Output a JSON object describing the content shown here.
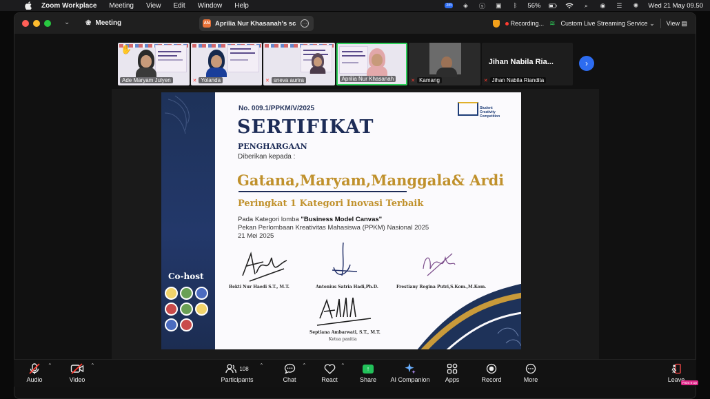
{
  "menubar": {
    "app": "Zoom Workplace",
    "items": [
      "Meeting",
      "View",
      "Edit",
      "Window",
      "Help"
    ],
    "battery": "56%",
    "zoom_badge": "zm",
    "datetime": "Wed 21 May  09.50"
  },
  "titlebar": {
    "meeting_label": "Meeting",
    "share_initials": "AN",
    "share_label": "Aprilia Nur Khasanah's scree",
    "recording": "Recording...",
    "stream": "Custom Live Streaming Service",
    "view": "View"
  },
  "participants": [
    {
      "name": "Ade Maryam Julyen",
      "muted": false
    },
    {
      "name": "Yolanda",
      "muted": true
    },
    {
      "name": "sneva aurira",
      "muted": true
    },
    {
      "name": "Aprilia Nur Khasanah",
      "muted": false,
      "active": true
    },
    {
      "name": "Kamang",
      "muted": true
    },
    {
      "name": "Jihan Nabila Riandita",
      "display": "Jihan Nabila Ria...",
      "muted": true
    }
  ],
  "thumb_poster": {
    "line1": "ANNOUNCEMENT",
    "line2": "OF THE WINNER",
    "line3": "Student Creativity",
    "line4": "Competition 2025"
  },
  "certificate": {
    "number": "No.  009.1/PPKM/V/2025",
    "title": "SERTIFIKAT",
    "subtitle": "PENGHARGAAN",
    "given_to": "Diberikan kepada :",
    "names": "Gatana,Maryam,Manggala& Ardi",
    "rank": "Peringkat 1 Kategori Inovasi Terbaik",
    "category_prefix": "Pada Kategori lomba ",
    "category_name": "\"Business Model Canvas\"",
    "event": "Pekan Perlombaan Kreativitas Mahasiswa (PPKM) Nasional 2025",
    "date": "21 Mei 2025",
    "brand_text": "Student Creativity Competition",
    "cohost": "Co-host",
    "signatories": [
      {
        "name": "Bekti Nur Haedi S.T., M.T."
      },
      {
        "name": "Antonius Satria Hadi,Ph.D."
      },
      {
        "name": "Frestiany Regina Putri,S.Kom.,M.Kom."
      },
      {
        "name": "Septiana Ambarwati, S.T., M.T.",
        "role": "Ketua panitia"
      }
    ]
  },
  "toolbar": {
    "audio": "Audio",
    "video": "Video",
    "participants": "Participants",
    "participant_count": "108",
    "chat": "Chat",
    "react": "React",
    "share": "Share",
    "ai": "AI Companion",
    "apps": "Apps",
    "record": "Record",
    "more": "More",
    "leave": "Leave",
    "paint_badge": "Paint It Up"
  },
  "colors": {
    "accent_blue": "#2d6cf0",
    "active_green": "#2ed15a",
    "rec_red": "#ff3b30",
    "cert_navy": "#1d2c57",
    "cert_gold": "#c0912c"
  }
}
